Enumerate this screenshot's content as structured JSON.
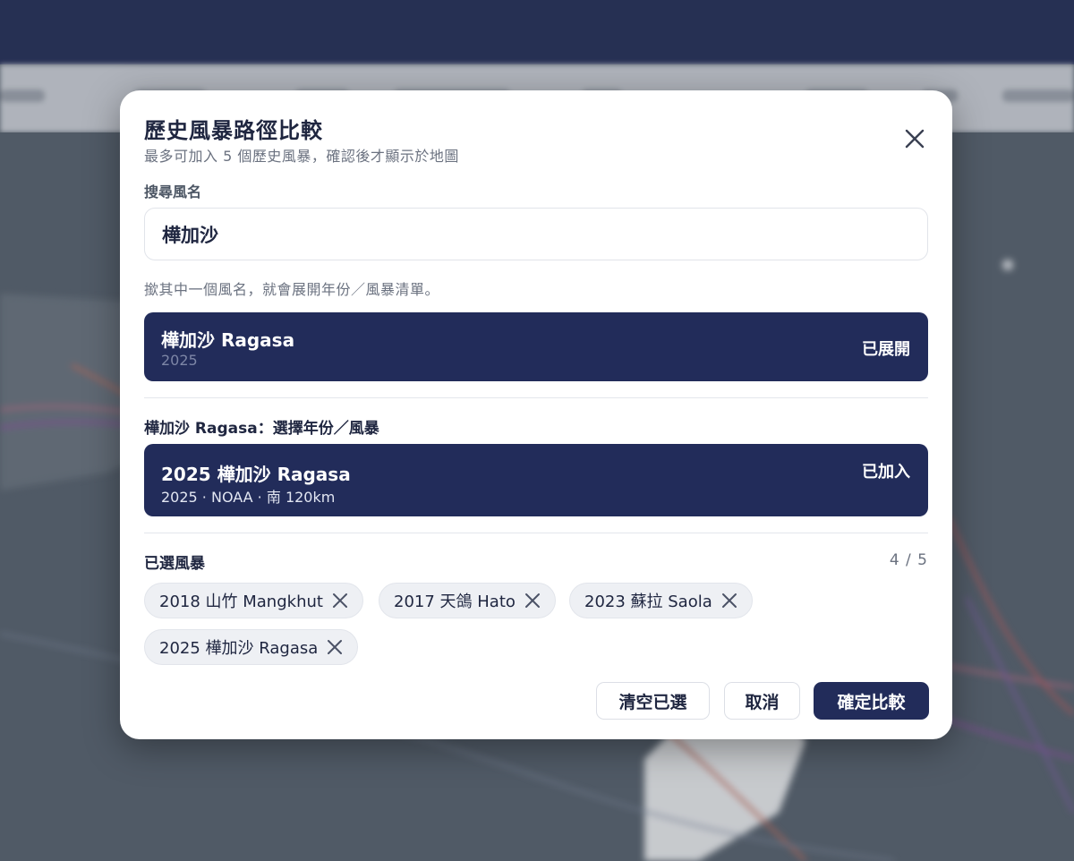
{
  "modal": {
    "title": "歷史風暴路徑比較",
    "subtitle": "最多可加入 5 個歷史風暴，確認後才顯示於地圖"
  },
  "search": {
    "label": "搜尋風名",
    "value": "樺加沙",
    "hint": "撳其中一個風名，就會展開年份／風暴清單。"
  },
  "name_results": [
    {
      "name": "樺加沙 Ragasa",
      "years": "2025",
      "state": "已展開"
    }
  ],
  "year_section": {
    "title": "樺加沙 Ragasa：選擇年份／風暴",
    "items": [
      {
        "name": "2025 樺加沙 Ragasa",
        "meta": "2025 · NOAA · 南 120km",
        "state": "已加入"
      }
    ]
  },
  "selected": {
    "title": "已選風暴",
    "count": "4 / 5",
    "chips": [
      {
        "label": "2018 山竹 Mangkhut"
      },
      {
        "label": "2017 天鴿 Hato"
      },
      {
        "label": "2023 蘇拉 Saola"
      },
      {
        "label": "2025 樺加沙 Ragasa"
      }
    ]
  },
  "actions": {
    "clear_label": "清空已選",
    "cancel_label": "取消",
    "confirm_label": "確定比較"
  },
  "icons": {
    "close": "close-icon",
    "chip_remove": "close-icon"
  },
  "colors": {
    "primary": "#222c5a",
    "topbar": "#222c55",
    "chip_bg": "#eef0f4",
    "map_bg": "#55606c"
  }
}
